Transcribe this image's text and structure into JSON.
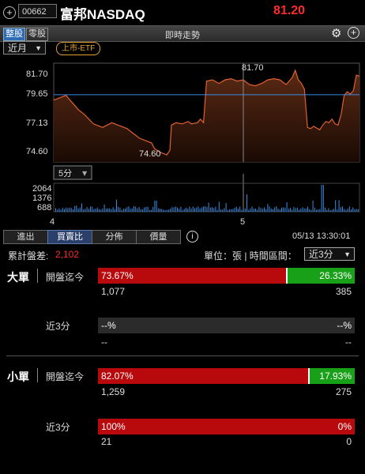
{
  "header": {
    "zoom_icon": "zoom-in-icon",
    "stock_code": "00662",
    "stock_name": "富邦NASDAQ",
    "price": "81.20"
  },
  "toolbar": {
    "tab_whole": "整股",
    "tab_odd": "零股",
    "title": "即時走勢"
  },
  "period": {
    "selected": "近月"
  },
  "badge": "上市-ETF",
  "chart": {
    "y_ticks": [
      "81.70",
      "79.65",
      "77.13",
      "74.60"
    ],
    "high_label": "81.70",
    "low_label": "74.60",
    "interval_select": "5分",
    "volume_ticks": [
      "2064",
      "1376",
      "688"
    ],
    "x_ticks": [
      "4",
      "5"
    ]
  },
  "chart_data": {
    "type": "area",
    "ylim": [
      74.0,
      82.3
    ],
    "price_ticks": [
      81.7,
      79.65,
      77.13,
      74.6
    ],
    "x": [
      "4",
      "5"
    ],
    "high": 81.7,
    "low": 74.6,
    "reference_line": 79.65,
    "colors": {
      "line": "#e06030",
      "reference": "#3a8ee6",
      "volume": "#3a8ee6"
    }
  },
  "tabs": [
    "進出",
    "買賣比",
    "分佈",
    "價量"
  ],
  "active_tab": 1,
  "timestamp": "05/13 13:30:01",
  "summary": {
    "cum_label": "累計盤差:",
    "cum_value": "2,102",
    "unit_label": "單位：張 | 時間區間：",
    "interval": "近3分"
  },
  "big": {
    "title": "大單",
    "open": {
      "label": "開盤迄今",
      "buy_pct": "73.67%",
      "sell_pct": "26.33%",
      "buy_ratio": 0.7367,
      "buy_qty": "1,077",
      "sell_qty": "385"
    },
    "recent": {
      "label": "近3分",
      "buy_pct": "--%",
      "sell_pct": "--%",
      "buy_qty": "--",
      "sell_qty": "--"
    }
  },
  "small": {
    "title": "小單",
    "open": {
      "label": "開盤迄今",
      "buy_pct": "82.07%",
      "sell_pct": "17.93%",
      "buy_ratio": 0.8207,
      "buy_qty": "1,259",
      "sell_qty": "275"
    },
    "recent": {
      "label": "近3分",
      "buy_pct": "100%",
      "sell_pct": "0%",
      "buy_ratio": 1.0,
      "buy_qty": "21",
      "sell_qty": "0"
    }
  },
  "colors": {
    "up": "#ff2a2a",
    "buy": "#b8090c",
    "sell": "#18a018",
    "accent": "#2e6bb5"
  }
}
